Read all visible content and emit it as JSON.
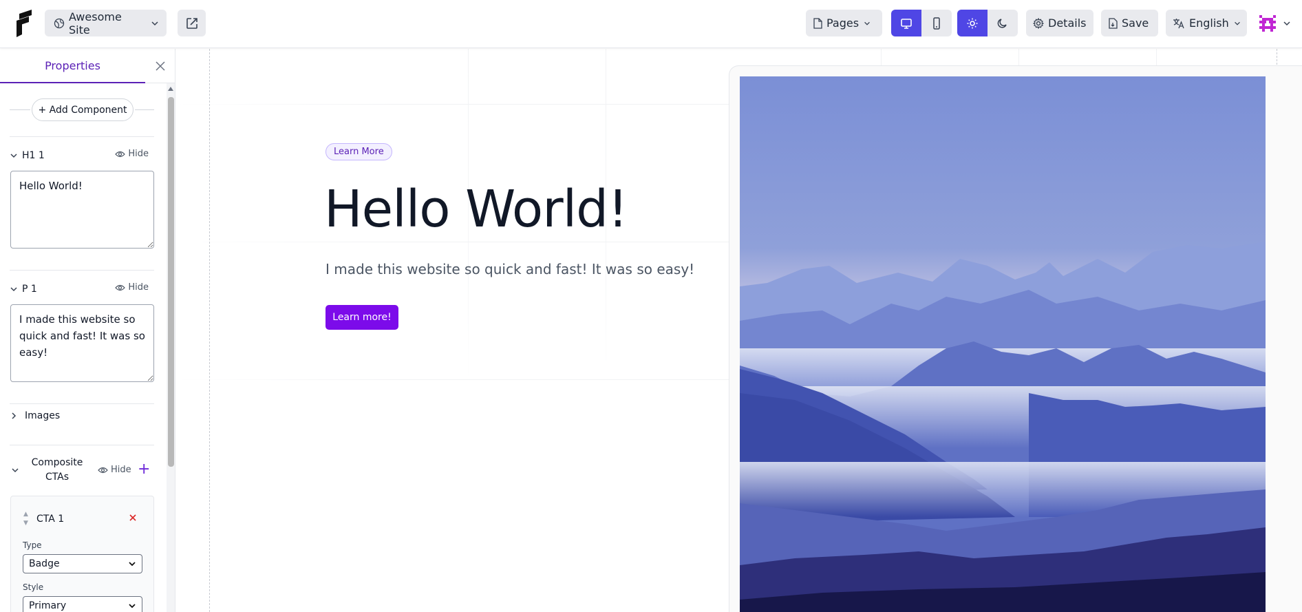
{
  "header": {
    "site_name": "Awesome Site",
    "pages_label": "Pages",
    "details_label": "Details",
    "save_label": "Save",
    "language_label": "English",
    "device_mode": "desktop",
    "theme_mode": "light"
  },
  "sidebar": {
    "tab_label": "Properties",
    "add_component_label": "+ Add Component",
    "hide_label": "Hide",
    "sections": {
      "h1": {
        "title": "H1 1",
        "value": "Hello World!"
      },
      "p": {
        "title": "P 1",
        "value": "I made this website so quick and fast! It was so easy!"
      },
      "images": {
        "title": "Images"
      },
      "composite": {
        "title": "Composite CTAs"
      }
    },
    "cta": {
      "title": "CTA 1",
      "type_label": "Type",
      "type_value": "Badge",
      "style_label": "Style",
      "style_value": "Primary"
    }
  },
  "canvas": {
    "badge_label": "Learn More",
    "heading": "Hello World!",
    "paragraph": "I made this website so quick and fast! It was so easy!",
    "button_label": "Learn more!"
  },
  "colors": {
    "accent": "#4f46e5",
    "brand_purple": "#7c0bea",
    "tab_purple": "#5b21b6",
    "avatar": "#c026d3"
  }
}
